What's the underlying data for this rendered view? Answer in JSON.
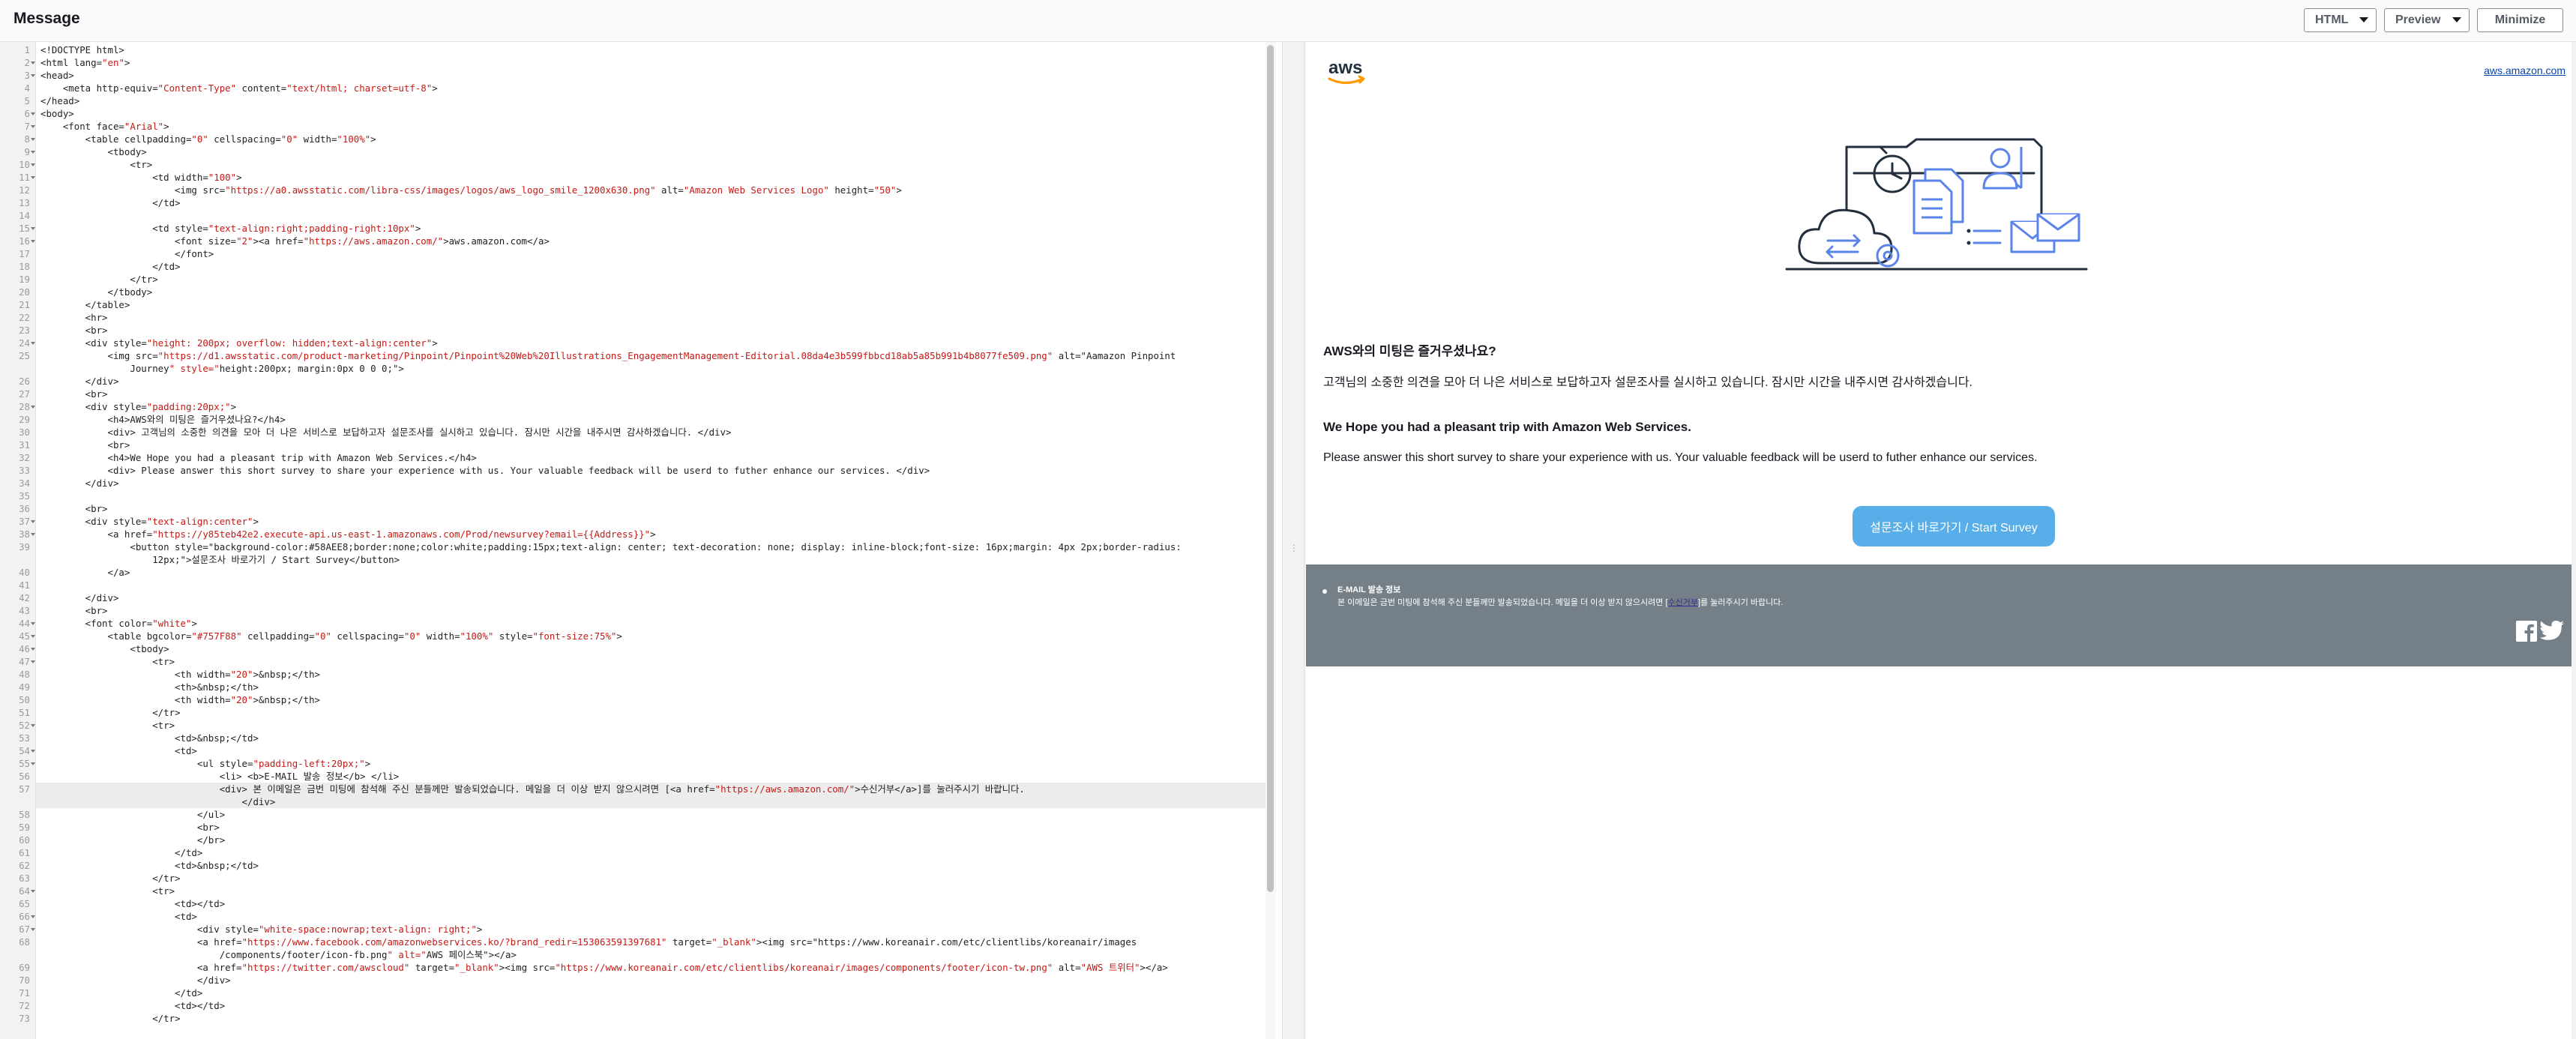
{
  "header": {
    "title": "Message",
    "format_label": "HTML",
    "view_label": "Preview",
    "minimize_label": "Minimize"
  },
  "code": [
    {
      "n": 1,
      "fold": false,
      "t": "<!DOCTYPE html>"
    },
    {
      "n": 2,
      "fold": true,
      "t": "<html lang=\"en\">"
    },
    {
      "n": 3,
      "fold": true,
      "t": "<head>"
    },
    {
      "n": 4,
      "fold": false,
      "t": "    <meta http-equiv=\"Content-Type\" content=\"text/html; charset=utf-8\">"
    },
    {
      "n": 5,
      "fold": false,
      "t": "</head>"
    },
    {
      "n": 6,
      "fold": true,
      "t": "<body>"
    },
    {
      "n": 7,
      "fold": true,
      "t": "    <font face=\"Arial\">"
    },
    {
      "n": 8,
      "fold": true,
      "t": "        <table cellpadding=\"0\" cellspacing=\"0\" width=\"100%\">"
    },
    {
      "n": 9,
      "fold": true,
      "t": "            <tbody>"
    },
    {
      "n": 10,
      "fold": true,
      "t": "                <tr>"
    },
    {
      "n": 11,
      "fold": true,
      "t": "                    <td width=\"100\">"
    },
    {
      "n": 12,
      "fold": false,
      "t": "                        <img src=\"https://a0.awsstatic.com/libra-css/images/logos/aws_logo_smile_1200x630.png\" alt=\"Amazon Web Services Logo\" height=\"50\">"
    },
    {
      "n": 13,
      "fold": false,
      "t": "                    </td>"
    },
    {
      "n": 14,
      "fold": false,
      "t": ""
    },
    {
      "n": 15,
      "fold": true,
      "t": "                    <td style=\"text-align:right;padding-right:10px\">"
    },
    {
      "n": 16,
      "fold": true,
      "t": "                        <font size=\"2\"><a href=\"https://aws.amazon.com/\">aws.amazon.com</a>"
    },
    {
      "n": 17,
      "fold": false,
      "t": "                        </font>"
    },
    {
      "n": 18,
      "fold": false,
      "t": "                    </td>"
    },
    {
      "n": 19,
      "fold": false,
      "t": "                </tr>"
    },
    {
      "n": 20,
      "fold": false,
      "t": "            </tbody>"
    },
    {
      "n": 21,
      "fold": false,
      "t": "        </table>"
    },
    {
      "n": 22,
      "fold": false,
      "t": "        <hr>"
    },
    {
      "n": 23,
      "fold": false,
      "t": "        <br>"
    },
    {
      "n": 24,
      "fold": true,
      "t": "        <div style=\"height: 200px; overflow: hidden;text-align:center\">"
    },
    {
      "n": 25,
      "fold": false,
      "t": "            <img src=\"https://d1.awsstatic.com/product-marketing/Pinpoint/Pinpoint%20Web%20Illustrations_EngagementManagement-Editorial.08da4e3b599fbbcd18ab5a85b991b4b8077fe509.png\" alt=\"Aamazon Pinpoint"
    },
    {
      "n": 0,
      "fold": false,
      "t": "                Journey\" style=\"height:200px; margin:0px 0 0 0;\">"
    },
    {
      "n": 26,
      "fold": false,
      "t": "        </div>"
    },
    {
      "n": 27,
      "fold": false,
      "t": "        <br>"
    },
    {
      "n": 28,
      "fold": true,
      "t": "        <div style=\"padding:20px;\">"
    },
    {
      "n": 29,
      "fold": false,
      "t": "            <h4>AWS와의 미팅은 즐거우셨나요?</h4>"
    },
    {
      "n": 30,
      "fold": false,
      "t": "            <div> 고객님의 소중한 의견을 모아 더 나은 서비스로 보답하고자 설문조사를 실시하고 있습니다. 잠시만 시간을 내주시면 감사하겠습니다. </div>"
    },
    {
      "n": 31,
      "fold": false,
      "t": "            <br>"
    },
    {
      "n": 32,
      "fold": false,
      "t": "            <h4>We Hope you had a pleasant trip with Amazon Web Services.</h4>"
    },
    {
      "n": 33,
      "fold": false,
      "t": "            <div> Please answer this short survey to share your experience with us. Your valuable feedback will be userd to futher enhance our services. </div>"
    },
    {
      "n": 34,
      "fold": false,
      "t": "        </div>"
    },
    {
      "n": 35,
      "fold": false,
      "t": ""
    },
    {
      "n": 36,
      "fold": false,
      "t": "        <br>"
    },
    {
      "n": 37,
      "fold": true,
      "t": "        <div style=\"text-align:center\">"
    },
    {
      "n": 38,
      "fold": true,
      "t": "            <a href=\"https://y85teb42e2.execute-api.us-east-1.amazonaws.com/Prod/newsurvey?email={{Address}}\">"
    },
    {
      "n": 39,
      "fold": false,
      "t": "                <button style=\"background-color:#58AEE8;border:none;color:white;padding:15px;text-align: center; text-decoration: none; display: inline-block;font-size: 16px;margin: 4px 2px;border-radius:"
    },
    {
      "n": 0,
      "fold": false,
      "t": "                    12px;\">설문조사 바로가기 / Start Survey</button>"
    },
    {
      "n": 40,
      "fold": false,
      "t": "            </a>"
    },
    {
      "n": 41,
      "fold": false,
      "t": ""
    },
    {
      "n": 42,
      "fold": false,
      "t": "        </div>"
    },
    {
      "n": 43,
      "fold": false,
      "t": "        <br>"
    },
    {
      "n": 44,
      "fold": true,
      "t": "        <font color=\"white\">"
    },
    {
      "n": 45,
      "fold": true,
      "t": "            <table bgcolor=\"#757F88\" cellpadding=\"0\" cellspacing=\"0\" width=\"100%\" style=\"font-size:75%\">"
    },
    {
      "n": 46,
      "fold": true,
      "t": "                <tbody>"
    },
    {
      "n": 47,
      "fold": true,
      "t": "                    <tr>"
    },
    {
      "n": 48,
      "fold": false,
      "t": "                        <th width=\"20\">&nbsp;</th>"
    },
    {
      "n": 49,
      "fold": false,
      "t": "                        <th>&nbsp;</th>"
    },
    {
      "n": 50,
      "fold": false,
      "t": "                        <th width=\"20\">&nbsp;</th>"
    },
    {
      "n": 51,
      "fold": false,
      "t": "                    </tr>"
    },
    {
      "n": 52,
      "fold": true,
      "t": "                    <tr>"
    },
    {
      "n": 53,
      "fold": false,
      "t": "                        <td>&nbsp;</td>"
    },
    {
      "n": 54,
      "fold": true,
      "t": "                        <td>"
    },
    {
      "n": 55,
      "fold": true,
      "t": "                            <ul style=\"padding-left:20px;\">"
    },
    {
      "n": 56,
      "fold": false,
      "t": "                                <li> <b>E-MAIL 발송 정보</b> </li>"
    },
    {
      "n": 57,
      "fold": false,
      "t": "                                <div> 본 이메일은 금번 미팅에 참석해 주신 분들께만 발송되었습니다. 메일을 더 이상 받지 않으시려면 [<a href=\"https://aws.amazon.com/\">수신거부</a>]를 눌러주시기 바랍니다."
    },
    {
      "n": 0,
      "fold": false,
      "t": "                                    </div>"
    },
    {
      "n": 58,
      "fold": false,
      "t": "                            </ul>"
    },
    {
      "n": 59,
      "fold": false,
      "t": "                            <br>"
    },
    {
      "n": 60,
      "fold": false,
      "t": "                            </br>"
    },
    {
      "n": 61,
      "fold": false,
      "t": "                        </td>"
    },
    {
      "n": 62,
      "fold": false,
      "t": "                        <td>&nbsp;</td>"
    },
    {
      "n": 63,
      "fold": false,
      "t": "                    </tr>"
    },
    {
      "n": 64,
      "fold": true,
      "t": "                    <tr>"
    },
    {
      "n": 65,
      "fold": false,
      "t": "                        <td></td>"
    },
    {
      "n": 66,
      "fold": true,
      "t": "                        <td>"
    },
    {
      "n": 67,
      "fold": true,
      "t": "                            <div style=\"white-space:nowrap;text-align: right;\">"
    },
    {
      "n": 68,
      "fold": false,
      "t": "                            <a href=\"https://www.facebook.com/amazonwebservices.ko/?brand_redir=153063591397681\" target=\"_blank\"><img src=\"https://www.koreanair.com/etc/clientlibs/koreanair/images"
    },
    {
      "n": 0,
      "fold": false,
      "t": "                                /components/footer/icon-fb.png\" alt=\"AWS 페이스북\"></a>"
    },
    {
      "n": 69,
      "fold": false,
      "t": "                            <a href=\"https://twitter.com/awscloud\" target=\"_blank\"><img src=\"https://www.koreanair.com/etc/clientlibs/koreanair/images/components/footer/icon-tw.png\" alt=\"AWS 트위터\"></a>"
    },
    {
      "n": 70,
      "fold": false,
      "t": "                            </div>"
    },
    {
      "n": 71,
      "fold": false,
      "t": "                        </td>"
    },
    {
      "n": 72,
      "fold": false,
      "t": "                        <td></td>"
    },
    {
      "n": 73,
      "fold": false,
      "t": "                    </tr>"
    }
  ],
  "preview": {
    "aws_link": "aws.amazon.com",
    "hero_alt": "Aamazon Pinpoint Journey",
    "h4_ko": "AWS와의 미팅은 즐거우셨나요?",
    "p_ko": "고객님의 소중한 의견을 모아 더 나은 서비스로 보답하고자 설문조사를 실시하고 있습니다. 잠시만 시간을 내주시면 감사하겠습니다.",
    "h4_en": "We Hope you had a pleasant trip with Amazon Web Services.",
    "p_en": "Please answer this short survey to share your experience with us. Your valuable feedback will be userd to futher enhance our services.",
    "button_label": "설문조사 바로가기 / Start Survey",
    "footer_title": "E-MAIL 발송 정보",
    "footer_text_before": "본 이메일은 금번 미팅에 참석해 주신 분들께만 발송되었습니다. 메일을 더 이상 받지 않으시려면 [",
    "footer_link": "수신거부",
    "footer_text_after": "]를 눌러주시기 바랍니다."
  },
  "colors": {
    "button": "#58AEE8",
    "footer_bg": "#757F88",
    "code_string": "#c41a16",
    "aws_orange": "#ff9900"
  }
}
